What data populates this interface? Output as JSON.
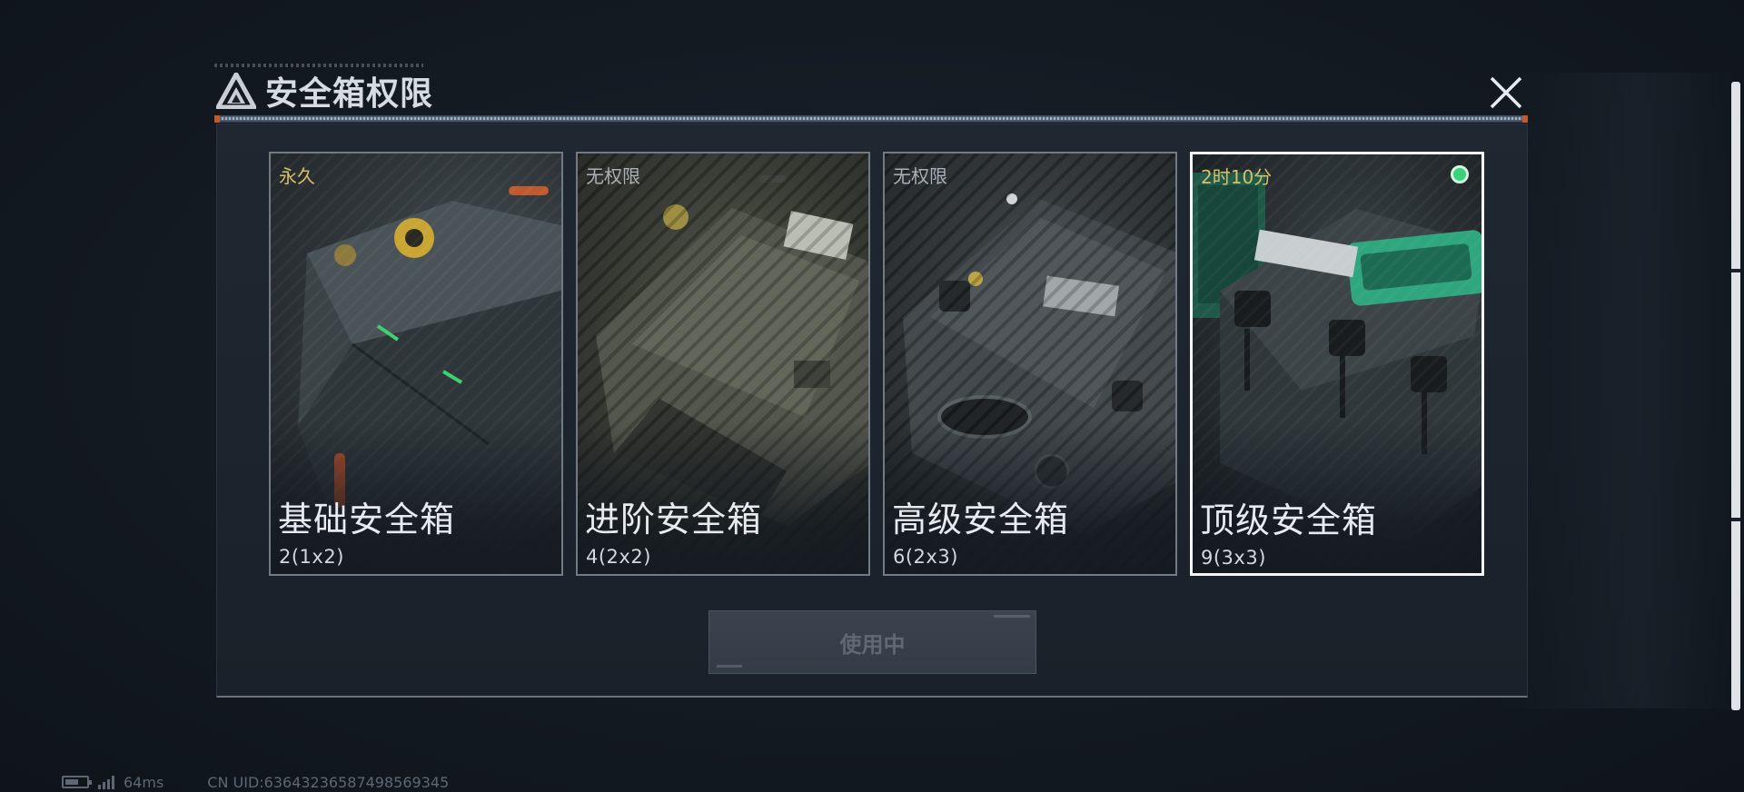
{
  "dialog": {
    "title": "安全箱权限",
    "close_icon": "close-x-icon",
    "logo_icon": "triangle-logo-icon"
  },
  "cards": [
    {
      "status": "永久",
      "status_color": "#d8c06a",
      "name": "基础安全箱",
      "capacity": "2(1x2)",
      "selected": false,
      "locked": false
    },
    {
      "status": "无权限",
      "status_color": "#a9b0b7",
      "name": "进阶安全箱",
      "capacity": "4(2x2)",
      "selected": false,
      "locked": true
    },
    {
      "status": "无权限",
      "status_color": "#a9b0b7",
      "name": "高级安全箱",
      "capacity": "6(2x3)",
      "selected": false,
      "locked": true
    },
    {
      "status": "2时10分",
      "status_color": "#d8c06a",
      "name": "顶级安全箱",
      "capacity": "9(3x3)",
      "selected": true,
      "locked": false,
      "active_indicator": "green-dot-icon"
    }
  ],
  "action": {
    "label": "使用中",
    "disabled": true
  },
  "footer": {
    "battery_icon": "battery-icon",
    "signal_icon": "signal-bars-icon",
    "ping": "64ms",
    "uid": "CN UID:6364323658749856934​5"
  },
  "colors": {
    "accent_gold": "#d8c06a",
    "active_green": "#3ad27a",
    "selected_border": "#f3f5f7"
  }
}
